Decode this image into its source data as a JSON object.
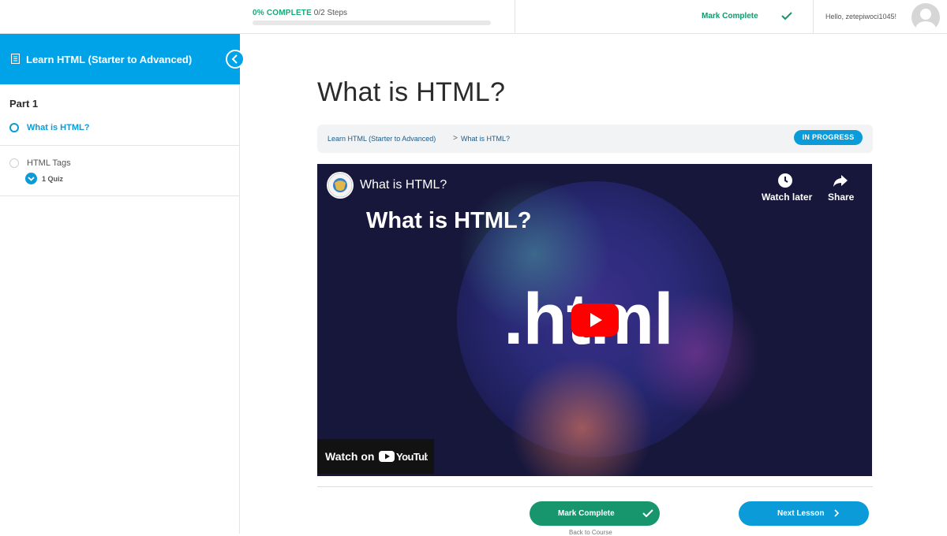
{
  "topbar": {
    "progress_pct_label": "0% COMPLETE",
    "progress_steps": "0/2 Steps",
    "progress_value": 0,
    "mark_complete_label": "Mark Complete",
    "greeting": "Hello, zetepiwoci1045!"
  },
  "sidebar": {
    "course_title": "Learn HTML (Starter to Advanced)",
    "part_title": "Part 1",
    "lessons": [
      {
        "label": "What is HTML?",
        "active": true
      },
      {
        "label": "HTML Tags",
        "active": false,
        "quiz_label": "1 Quiz"
      }
    ]
  },
  "main": {
    "title": "What is HTML?",
    "breadcrumb": {
      "course": "Learn HTML (Starter to Advanced)",
      "separator": ">",
      "lesson": "What is HTML?"
    },
    "status": "IN PROGRESS",
    "video": {
      "title": "What is HTML?",
      "watch_later": "Watch later",
      "share": "Share",
      "overlay_title": "What is HTML?",
      "big_text": ".html",
      "watch_on": "Watch on",
      "platform": "YouTube"
    },
    "mark_complete_label": "Mark Complete",
    "next_lesson_label": "Next Lesson",
    "back_to_course": "Back to Course"
  },
  "colors": {
    "accent_blue": "#00a2e8",
    "complete_green": "#17956c",
    "video_bg": "#16163a"
  }
}
